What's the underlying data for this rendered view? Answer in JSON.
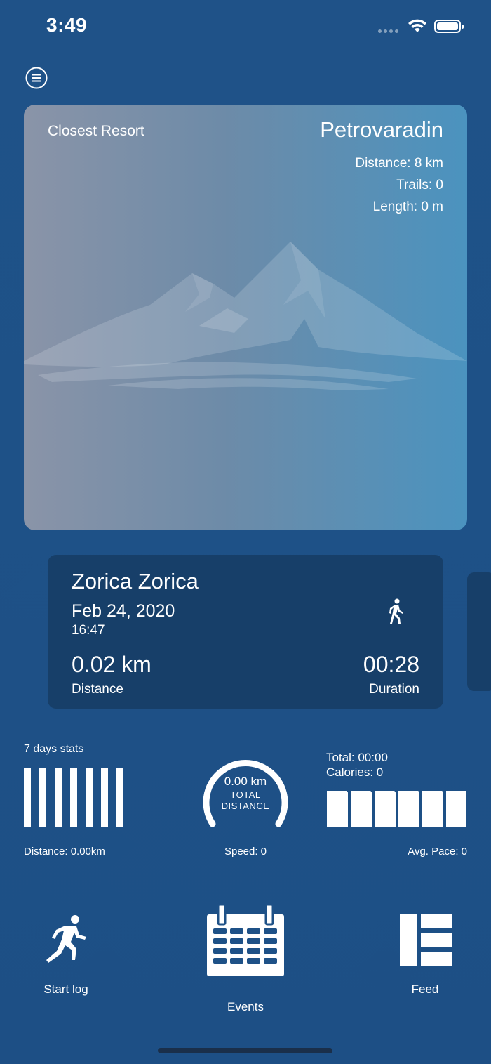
{
  "status_bar": {
    "time": "3:49"
  },
  "resort": {
    "label": "Closest Resort",
    "name": "Petrovaradin",
    "distance": "Distance: 8 km",
    "trails": "Trails: 0",
    "length": "Length: 0 m"
  },
  "activity": {
    "user": "Zorica Zorica",
    "date": "Feb 24, 2020",
    "time": "16:47",
    "distance_value": "0.02 km",
    "distance_label": "Distance",
    "duration_value": "00:28",
    "duration_label": "Duration",
    "icon": "walking-icon"
  },
  "stats": {
    "title": "7 days stats",
    "distance": "Distance: 0.00km",
    "gauge_value": "0.00 km",
    "gauge_label_1": "TOTAL",
    "gauge_label_2": "DISTANCE",
    "speed": "Speed: 0",
    "total": "Total: 00:00",
    "calories": "Calories: 0",
    "avg_pace": "Avg. Pace: 0"
  },
  "actions": {
    "start_log": "Start log",
    "events": "Events",
    "feed": "Feed"
  },
  "colors": {
    "background": "#1e5187",
    "card_dark": "#173f69",
    "resort_gradient_start": "#8a94a8",
    "resort_gradient_end": "#4b93bf"
  }
}
